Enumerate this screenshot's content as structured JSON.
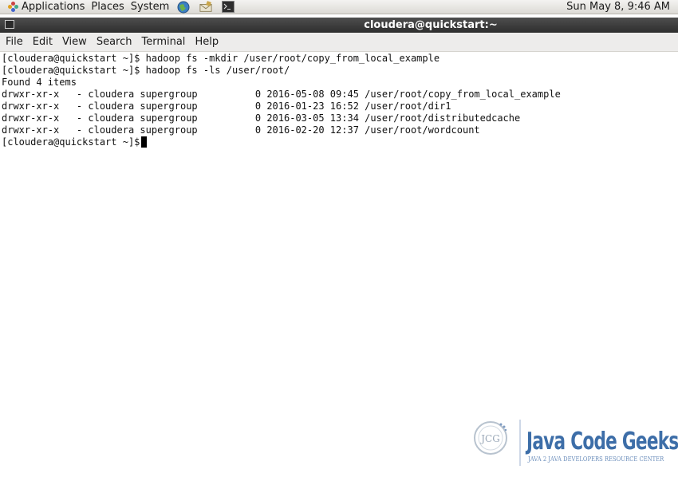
{
  "top_panel": {
    "menus": [
      "Applications",
      "Places",
      "System"
    ],
    "launchers": [
      "web-browser-icon",
      "email-client-icon",
      "terminal-launcher-icon"
    ],
    "clock": "Sun May  8,  9:46 AM"
  },
  "window": {
    "title": "cloudera@quickstart:~"
  },
  "menubar": {
    "items": [
      "File",
      "Edit",
      "View",
      "Search",
      "Terminal",
      "Help"
    ]
  },
  "terminal": {
    "lines": [
      "[cloudera@quickstart ~]$ hadoop fs -mkdir /user/root/copy_from_local_example",
      "[cloudera@quickstart ~]$ hadoop fs -ls /user/root/",
      "Found 4 items",
      "drwxr-xr-x   - cloudera supergroup          0 2016-05-08 09:45 /user/root/copy_from_local_example",
      "drwxr-xr-x   - cloudera supergroup          0 2016-01-23 16:52 /user/root/dir1",
      "drwxr-xr-x   - cloudera supergroup          0 2016-03-05 13:34 /user/root/distributedcache",
      "drwxr-xr-x   - cloudera supergroup          0 2016-02-20 12:37 /user/root/wordcount",
      "[cloudera@quickstart ~]$ "
    ]
  },
  "watermark": {
    "logo_text": "JCG",
    "title": "Java Code Geeks",
    "subtitle": "JAVA 2 JAVA DEVELOPERS RESOURCE CENTER"
  },
  "colors": {
    "titlebar": "#3a3a3a",
    "panel": "#e6e4df",
    "watermark_blue": "#3d6ea8"
  }
}
